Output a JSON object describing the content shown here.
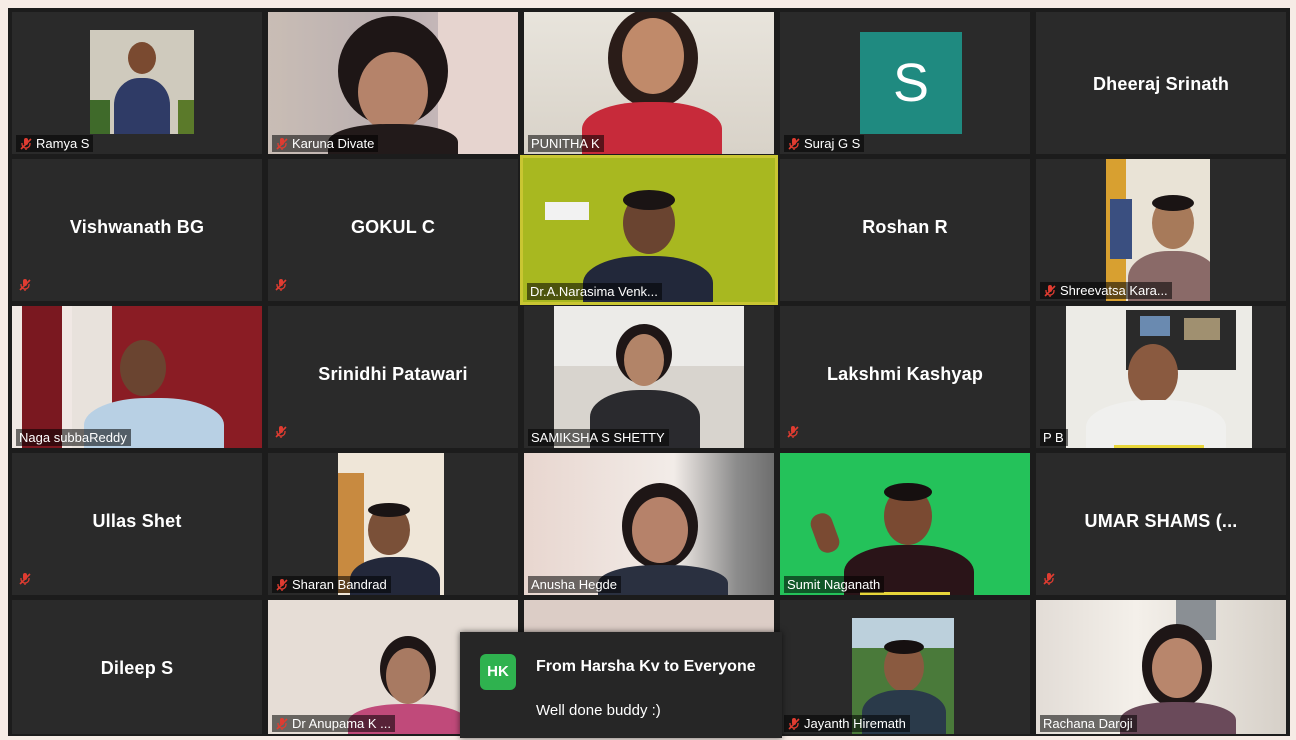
{
  "participants": [
    {
      "name": "Ramya S",
      "muted": true,
      "video": true
    },
    {
      "name": "Karuna Divate",
      "muted": true,
      "video": true
    },
    {
      "name": "PUNITHA K",
      "muted": false,
      "video": true
    },
    {
      "name": "Suraj G S",
      "muted": true,
      "video": false,
      "avatar_letter": "S"
    },
    {
      "name": "Dheeraj Srinath",
      "muted": false,
      "video": false
    },
    {
      "name": "Vishwanath BG",
      "muted": true,
      "video": false
    },
    {
      "name": "GOKUL C",
      "muted": true,
      "video": false
    },
    {
      "name": "Dr.A.Narasima Venk...",
      "muted": false,
      "video": true,
      "active_speaker": true
    },
    {
      "name": "Roshan R",
      "muted": false,
      "video": false
    },
    {
      "name": "Shreevatsa Kara...",
      "muted": true,
      "video": true
    },
    {
      "name": "Naga subbaReddy",
      "muted": false,
      "video": true
    },
    {
      "name": "Srinidhi Patawari",
      "muted": true,
      "video": false
    },
    {
      "name": "SAMIKSHA S SHETTY",
      "muted": false,
      "video": true
    },
    {
      "name": "Lakshmi Kashyap",
      "muted": true,
      "video": false
    },
    {
      "name": "P B",
      "muted": false,
      "video": true
    },
    {
      "name": "Ullas Shet",
      "muted": true,
      "video": false
    },
    {
      "name": "Sharan Bandrad",
      "muted": true,
      "video": true
    },
    {
      "name": "Anusha Hegde",
      "muted": false,
      "video": true
    },
    {
      "name": "Sumit Naganath",
      "muted": false,
      "video": true
    },
    {
      "name": "UMAR SHAMS (...",
      "muted": true,
      "video": false
    },
    {
      "name": "Dileep S",
      "muted": false,
      "video": false
    },
    {
      "name": "Dr Anupama K ...",
      "muted": true,
      "video": true
    },
    {
      "name": "",
      "muted": false,
      "video": true
    },
    {
      "name": "Jayanth Hiremath",
      "muted": true,
      "video": true
    },
    {
      "name": "Rachana Daroji",
      "muted": false,
      "video": true
    }
  ],
  "chat_notification": {
    "initials": "HK",
    "from": "From Harsha Kv to Everyone",
    "message": "Well done buddy :)"
  },
  "colors": {
    "tile_bg": "#2a2a2a",
    "active_border": "#c9c632",
    "mute_icon": "#e03c31",
    "avatar_bg": "#1f8a80",
    "chat_badge": "#2fb24f"
  }
}
